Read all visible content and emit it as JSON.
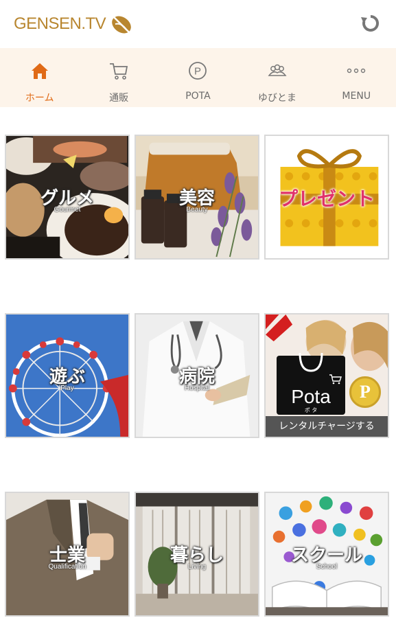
{
  "header": {
    "logo_text": "GENSEN.TV",
    "brand_color": "#b8862f",
    "logo_icon": "bean-icon",
    "refresh_icon": "refresh-icon"
  },
  "nav": {
    "active_color": "#e06a16",
    "items": [
      {
        "label": "ホーム",
        "icon": "home-icon",
        "active": true
      },
      {
        "label": "通販",
        "icon": "cart-icon",
        "active": false
      },
      {
        "label": "POTA",
        "icon": "p-circle-icon",
        "active": false
      },
      {
        "label": "ゆびとま",
        "icon": "people-icon",
        "active": false
      },
      {
        "label": "MENU",
        "icon": "dots-icon",
        "active": false
      }
    ]
  },
  "tiles": {
    "gourmet": {
      "label": "グルメ",
      "sub": "Gourmet"
    },
    "beauty": {
      "label": "美容",
      "sub": "Beauty"
    },
    "present": {
      "label": "プレゼント"
    },
    "play": {
      "label": "遊ぶ",
      "sub": "Play"
    },
    "hospital": {
      "label": "病院",
      "sub": "Hospital"
    },
    "pota": {
      "logo": "Pota",
      "kana": "ポ タ",
      "coin": "P",
      "bar": "レンタルチャージする"
    },
    "qualification": {
      "label": "士業",
      "sub": "Qualification"
    },
    "living": {
      "label": "暮らし",
      "sub": "Living"
    },
    "school": {
      "label": "スクール",
      "sub": "School"
    }
  }
}
